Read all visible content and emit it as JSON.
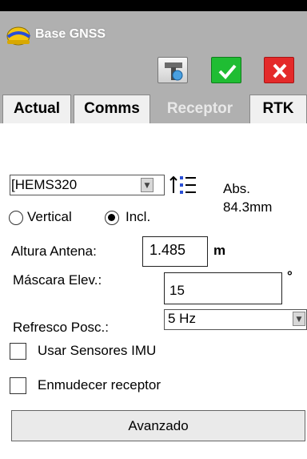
{
  "window": {
    "title": "Base GNSS"
  },
  "toolbar": {
    "tool_icon": "configure-tool-icon",
    "ok_icon": "checkmark-icon",
    "cancel_icon": "close-icon"
  },
  "tabs": [
    {
      "label": "Actual",
      "active": false
    },
    {
      "label": "Comms",
      "active": false
    },
    {
      "label": "Receptor",
      "active": true
    },
    {
      "label": "RTK",
      "active": false
    }
  ],
  "receiver": {
    "model": "[HEMS320",
    "abs_label": "Abs.",
    "abs_value": "84.3mm"
  },
  "measure": {
    "options": [
      {
        "label": "Vertical",
        "selected": false
      },
      {
        "label": "Incl.",
        "selected": true
      }
    ]
  },
  "antenna": {
    "label": "Altura Antena:",
    "value": "1.485",
    "unit": "m"
  },
  "mask": {
    "label": "Máscara Elev.:",
    "value": "15",
    "unit": "°"
  },
  "refresh": {
    "label": "Refresco Posc.:",
    "value": "5 Hz"
  },
  "checkboxes": [
    {
      "label": "Usar Sensores IMU",
      "checked": false
    },
    {
      "label": "Enmudecer receptor",
      "checked": false
    }
  ],
  "advanced_button": "Avanzado",
  "colors": {
    "ok": "#1fbd33",
    "cancel": "#e42a2a",
    "titlebar": "#b0b0b0"
  }
}
